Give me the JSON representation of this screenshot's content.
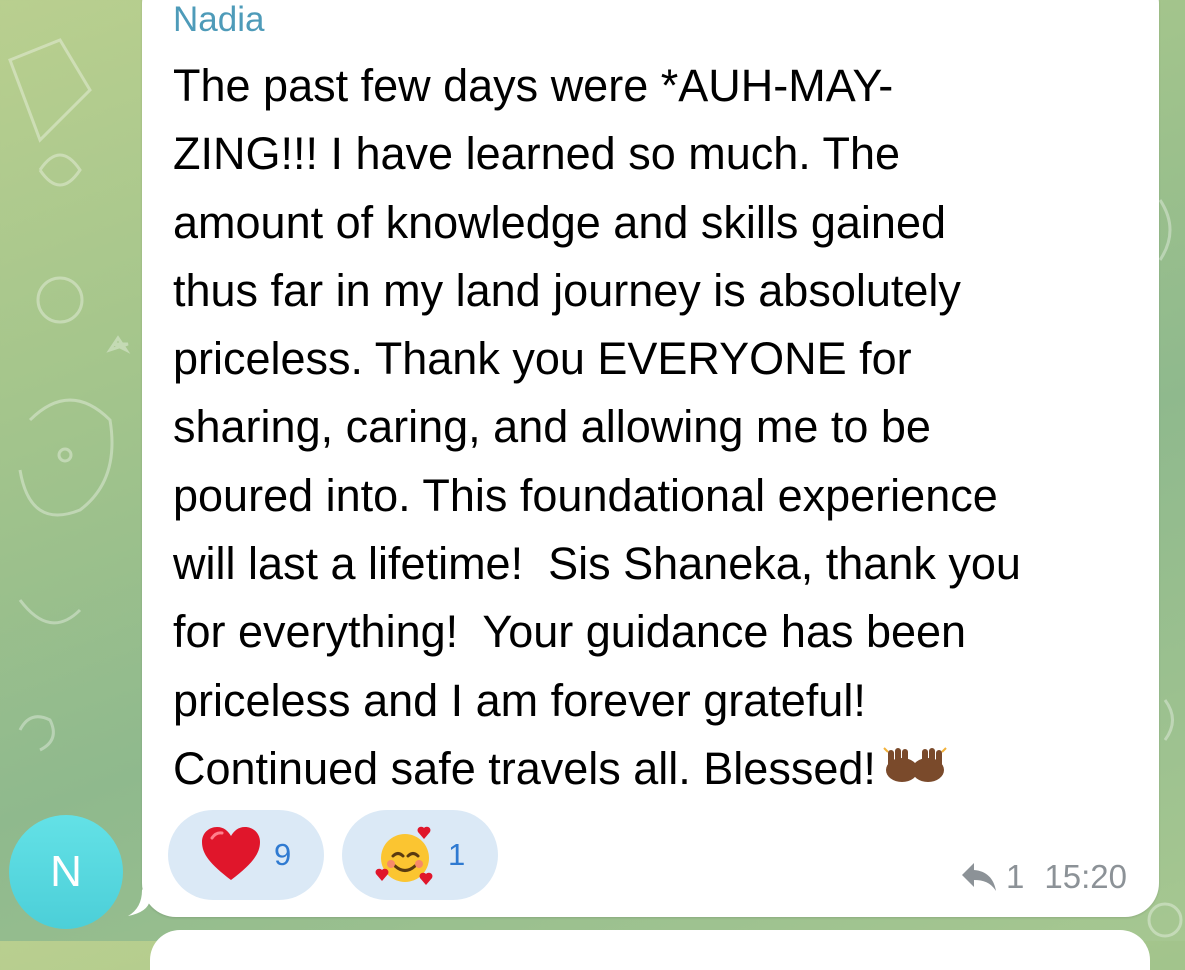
{
  "message": {
    "sender": "Nadia",
    "lines": [
      "The past few days were *AUH-MAY-",
      "ZING!!! I have learned so much. The",
      "amount of knowledge and skills gained",
      "thus far in my land journey is absolutely",
      "priceless. Thank you EVERYONE for",
      "sharing, caring, and allowing me to be",
      "poured into. This foundational experience",
      "will last a lifetime!  Sis Shaneka, thank you",
      "for everything!  Your guidance has been",
      "priceless and I am forever grateful!",
      "Continued safe travels all. Blessed!"
    ],
    "trailing_emoji": "raising-hands-emoji"
  },
  "reactions": [
    {
      "emoji": "red-heart-emoji",
      "count": "9"
    },
    {
      "emoji": "smiling-face-with-hearts-emoji",
      "count": "1"
    }
  ],
  "meta": {
    "reply_count": "1",
    "time": "15:20"
  },
  "avatar": {
    "initial": "N",
    "color": "#55d6de"
  },
  "colors": {
    "sender_name": "#4e9bb9",
    "reaction_bg": "#dbe9f6",
    "reaction_count": "#2f7ad1",
    "meta": "#8c9297"
  }
}
